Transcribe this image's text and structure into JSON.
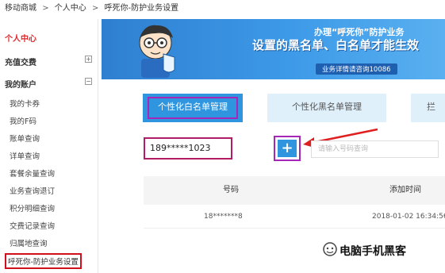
{
  "breadcrumb": [
    "移动商城",
    "个人中心",
    "呼死你-防护业务设置"
  ],
  "breadcrumb_separator": ">",
  "sidebar": {
    "title": "个人中心",
    "groups": [
      {
        "label": "充值交费",
        "toggle": "+"
      },
      {
        "label": "我的账户",
        "toggle": "−"
      }
    ],
    "items": [
      {
        "label": "我的卡券"
      },
      {
        "label": "我的F码"
      },
      {
        "label": "账单查询"
      },
      {
        "label": "详单查询"
      },
      {
        "label": "套餐余量查询"
      },
      {
        "label": "业务查询退订"
      },
      {
        "label": "积分明细查询"
      },
      {
        "label": "交费记录查询"
      },
      {
        "label": "归属地查询"
      },
      {
        "label": "呼死你-防护业务设置",
        "active": true
      }
    ]
  },
  "banner": {
    "line1": "办理“呼死你”防护业务",
    "line2": "设置的黑名单、白名单才能生效",
    "line3": "业务详情请咨询10086"
  },
  "tabs": [
    {
      "label": "个性化白名单管理",
      "active": true
    },
    {
      "label": "个性化黑名单管理"
    },
    {
      "label": "拦"
    }
  ],
  "phone_input": {
    "value": "189*****1023"
  },
  "add_button": {
    "label": "+"
  },
  "search_input": {
    "placeholder": "请输入号码查询"
  },
  "table": {
    "columns": [
      "号码",
      "添加时间"
    ],
    "rows": [
      {
        "number": "18*******8",
        "time": "2018-01-02 16:34:56"
      }
    ]
  },
  "watermark": {
    "text": "电脑手机黑客"
  },
  "colors": {
    "accent_blue": "#2e95de",
    "highlight_red": "#d0111b",
    "highlight_purple": "#a626b7",
    "sidebar_title": "#e0262b"
  }
}
